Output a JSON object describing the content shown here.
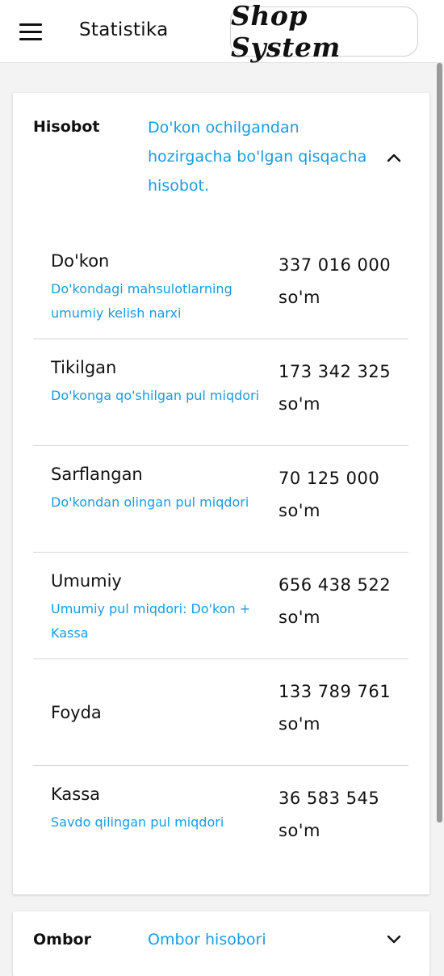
{
  "header": {
    "title": "Statistika",
    "brand": "Shop System"
  },
  "hisobot": {
    "label": "Hisobot",
    "description": "Do'kon ochilgandan hozirgacha bo'lgan qisqacha hisobot.",
    "expanded": true,
    "items": [
      {
        "name": "Do'kon",
        "description": "Do'kondagi mahsulotlarning umumiy kelish narxi",
        "amount": "337 016 000",
        "currency": "so'm"
      },
      {
        "name": "Tikilgan",
        "description": "Do'konga qo'shilgan pul miqdori",
        "amount": "173 342 325",
        "currency": "so'm"
      },
      {
        "name": "Sarflangan",
        "description": "Do'kondan olingan pul miqdori",
        "amount": "70 125 000",
        "currency": "so'm"
      },
      {
        "name": "Umumiy",
        "description": "Umumiy pul miqdori: Do'kon + Kassa",
        "amount": "656 438 522",
        "currency": "so'm"
      },
      {
        "name": "Foyda",
        "description": "",
        "amount": "133 789 761",
        "currency": "so'm"
      },
      {
        "name": "Kassa",
        "description": "Savdo qilingan pul miqdori",
        "amount": "36 583 545",
        "currency": "so'm"
      }
    ]
  },
  "ombor": {
    "label": "Ombor",
    "description": "Ombor hisobori",
    "expanded": false
  },
  "colors": {
    "accent": "#1a9be0",
    "text": "#111111",
    "background": "#f3f3f3"
  },
  "icons": {
    "menu": "hamburger-menu-icon",
    "collapse": "chevron-up-icon",
    "expand": "chevron-down-icon"
  }
}
